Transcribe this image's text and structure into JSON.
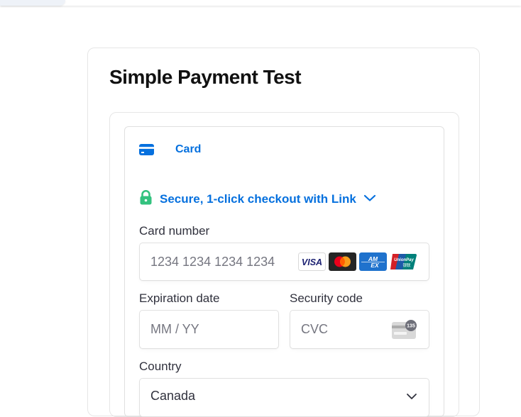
{
  "page": {
    "title": "Simple Payment Test"
  },
  "payment_method_tab": {
    "label": "Card",
    "icon": "card-icon"
  },
  "link_checkout": {
    "label": "Secure, 1-click checkout with Link",
    "icon": "lock-icon",
    "color": "#0570de",
    "lock_color": "#33c27f"
  },
  "card_number": {
    "label": "Card number",
    "placeholder": "1234 1234 1234 1234",
    "brands": [
      "VISA",
      "Mastercard",
      "AMEX",
      "UnionPay"
    ]
  },
  "expiration": {
    "label": "Expiration date",
    "placeholder": "MM / YY"
  },
  "security_code": {
    "label": "Security code",
    "placeholder": "CVC",
    "icon_text": "135"
  },
  "country": {
    "label": "Country",
    "value": "Canada"
  }
}
